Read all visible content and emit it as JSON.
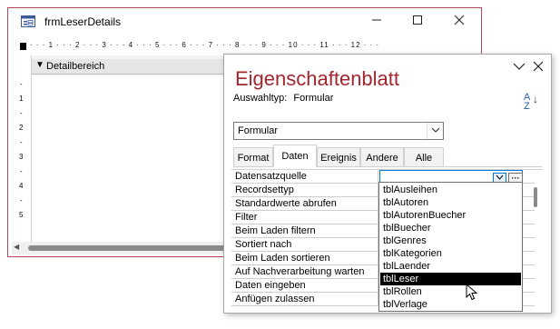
{
  "form_window": {
    "title": "frmLeserDetails",
    "ruler_ticks": "· · · 1 · · · 2 · · · 3 · · · 4 · · · 5 · · · 6 · · · 7 · · · 8 · · · 9 · · · 10 · · · 11 · · · 12 · · ·",
    "vruler": [
      "-",
      "1",
      "-",
      "2",
      "-",
      "3",
      "-",
      "4",
      "-",
      "5"
    ],
    "section_label": "Detailbereich",
    "section_icon": "arrow-down-icon"
  },
  "property_sheet": {
    "title": "Eigenschaftenblatt",
    "selection_type_label": "Auswahltyp:",
    "selection_type_value": "Formular",
    "sort_icon_label_top": "A",
    "sort_icon_label_bottom": "Z",
    "object_combo_value": "Formular",
    "tabs": [
      "Format",
      "Daten",
      "Ereignis",
      "Andere",
      "Alle"
    ],
    "active_tab": "Daten",
    "properties": [
      "Datensatzquelle",
      "Recordsettyp",
      "Standardwerte abrufen",
      "Filter",
      "Beim Laden filtern",
      "Sortiert nach",
      "Beim Laden sortieren",
      "Auf Nachverarbeitung warten",
      "Daten eingeben",
      "Anfügen zulassen"
    ],
    "builder_button": "···"
  },
  "dropdown": {
    "items": [
      "tblAusleihen",
      "tblAutoren",
      "tblAutorenBuecher",
      "tblBuecher",
      "tblGenres",
      "tblKategorien",
      "tblLaender",
      "tblLeser",
      "tblRollen",
      "tblVerlage"
    ],
    "selected": "tblLeser"
  },
  "colors": {
    "accent_title": "#a3262e",
    "window_border": "#b4465a",
    "focus_blue": "#0078d7",
    "selection": "#000000"
  }
}
